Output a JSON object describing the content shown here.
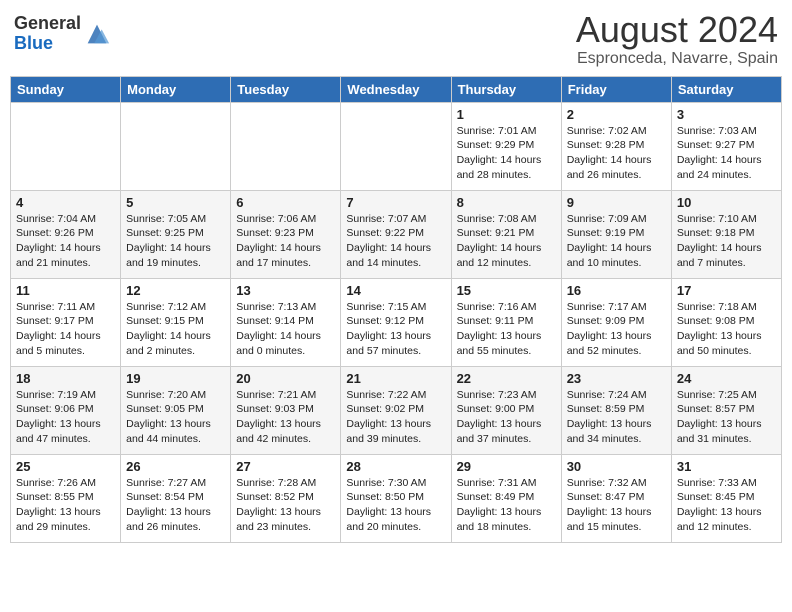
{
  "header": {
    "logo_general": "General",
    "logo_blue": "Blue",
    "month_year": "August 2024",
    "location": "Espronceda, Navarre, Spain"
  },
  "days_of_week": [
    "Sunday",
    "Monday",
    "Tuesday",
    "Wednesday",
    "Thursday",
    "Friday",
    "Saturday"
  ],
  "weeks": [
    [
      {
        "day": "",
        "info": ""
      },
      {
        "day": "",
        "info": ""
      },
      {
        "day": "",
        "info": ""
      },
      {
        "day": "",
        "info": ""
      },
      {
        "day": "1",
        "info": "Sunrise: 7:01 AM\nSunset: 9:29 PM\nDaylight: 14 hours\nand 28 minutes."
      },
      {
        "day": "2",
        "info": "Sunrise: 7:02 AM\nSunset: 9:28 PM\nDaylight: 14 hours\nand 26 minutes."
      },
      {
        "day": "3",
        "info": "Sunrise: 7:03 AM\nSunset: 9:27 PM\nDaylight: 14 hours\nand 24 minutes."
      }
    ],
    [
      {
        "day": "4",
        "info": "Sunrise: 7:04 AM\nSunset: 9:26 PM\nDaylight: 14 hours\nand 21 minutes."
      },
      {
        "day": "5",
        "info": "Sunrise: 7:05 AM\nSunset: 9:25 PM\nDaylight: 14 hours\nand 19 minutes."
      },
      {
        "day": "6",
        "info": "Sunrise: 7:06 AM\nSunset: 9:23 PM\nDaylight: 14 hours\nand 17 minutes."
      },
      {
        "day": "7",
        "info": "Sunrise: 7:07 AM\nSunset: 9:22 PM\nDaylight: 14 hours\nand 14 minutes."
      },
      {
        "day": "8",
        "info": "Sunrise: 7:08 AM\nSunset: 9:21 PM\nDaylight: 14 hours\nand 12 minutes."
      },
      {
        "day": "9",
        "info": "Sunrise: 7:09 AM\nSunset: 9:19 PM\nDaylight: 14 hours\nand 10 minutes."
      },
      {
        "day": "10",
        "info": "Sunrise: 7:10 AM\nSunset: 9:18 PM\nDaylight: 14 hours\nand 7 minutes."
      }
    ],
    [
      {
        "day": "11",
        "info": "Sunrise: 7:11 AM\nSunset: 9:17 PM\nDaylight: 14 hours\nand 5 minutes."
      },
      {
        "day": "12",
        "info": "Sunrise: 7:12 AM\nSunset: 9:15 PM\nDaylight: 14 hours\nand 2 minutes."
      },
      {
        "day": "13",
        "info": "Sunrise: 7:13 AM\nSunset: 9:14 PM\nDaylight: 14 hours\nand 0 minutes."
      },
      {
        "day": "14",
        "info": "Sunrise: 7:15 AM\nSunset: 9:12 PM\nDaylight: 13 hours\nand 57 minutes."
      },
      {
        "day": "15",
        "info": "Sunrise: 7:16 AM\nSunset: 9:11 PM\nDaylight: 13 hours\nand 55 minutes."
      },
      {
        "day": "16",
        "info": "Sunrise: 7:17 AM\nSunset: 9:09 PM\nDaylight: 13 hours\nand 52 minutes."
      },
      {
        "day": "17",
        "info": "Sunrise: 7:18 AM\nSunset: 9:08 PM\nDaylight: 13 hours\nand 50 minutes."
      }
    ],
    [
      {
        "day": "18",
        "info": "Sunrise: 7:19 AM\nSunset: 9:06 PM\nDaylight: 13 hours\nand 47 minutes."
      },
      {
        "day": "19",
        "info": "Sunrise: 7:20 AM\nSunset: 9:05 PM\nDaylight: 13 hours\nand 44 minutes."
      },
      {
        "day": "20",
        "info": "Sunrise: 7:21 AM\nSunset: 9:03 PM\nDaylight: 13 hours\nand 42 minutes."
      },
      {
        "day": "21",
        "info": "Sunrise: 7:22 AM\nSunset: 9:02 PM\nDaylight: 13 hours\nand 39 minutes."
      },
      {
        "day": "22",
        "info": "Sunrise: 7:23 AM\nSunset: 9:00 PM\nDaylight: 13 hours\nand 37 minutes."
      },
      {
        "day": "23",
        "info": "Sunrise: 7:24 AM\nSunset: 8:59 PM\nDaylight: 13 hours\nand 34 minutes."
      },
      {
        "day": "24",
        "info": "Sunrise: 7:25 AM\nSunset: 8:57 PM\nDaylight: 13 hours\nand 31 minutes."
      }
    ],
    [
      {
        "day": "25",
        "info": "Sunrise: 7:26 AM\nSunset: 8:55 PM\nDaylight: 13 hours\nand 29 minutes."
      },
      {
        "day": "26",
        "info": "Sunrise: 7:27 AM\nSunset: 8:54 PM\nDaylight: 13 hours\nand 26 minutes."
      },
      {
        "day": "27",
        "info": "Sunrise: 7:28 AM\nSunset: 8:52 PM\nDaylight: 13 hours\nand 23 minutes."
      },
      {
        "day": "28",
        "info": "Sunrise: 7:30 AM\nSunset: 8:50 PM\nDaylight: 13 hours\nand 20 minutes."
      },
      {
        "day": "29",
        "info": "Sunrise: 7:31 AM\nSunset: 8:49 PM\nDaylight: 13 hours\nand 18 minutes."
      },
      {
        "day": "30",
        "info": "Sunrise: 7:32 AM\nSunset: 8:47 PM\nDaylight: 13 hours\nand 15 minutes."
      },
      {
        "day": "31",
        "info": "Sunrise: 7:33 AM\nSunset: 8:45 PM\nDaylight: 13 hours\nand 12 minutes."
      }
    ]
  ]
}
